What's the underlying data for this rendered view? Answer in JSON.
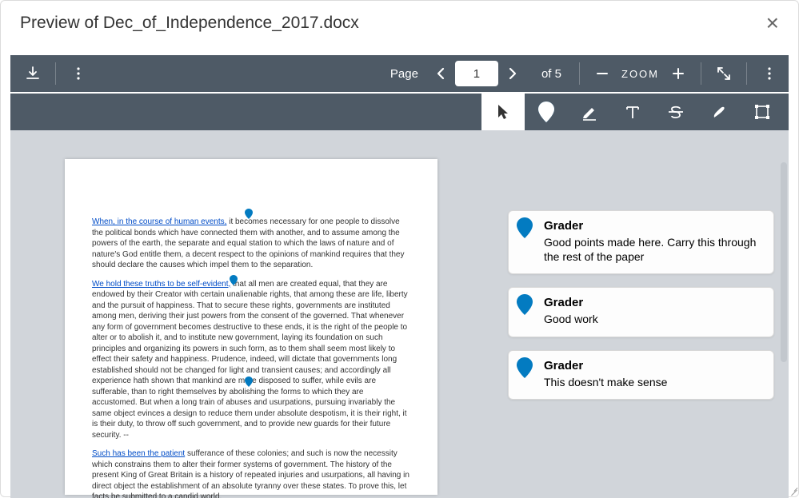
{
  "header": {
    "title": "Preview of Dec_of_Independence_2017.docx"
  },
  "toolbar": {
    "page_label": "Page",
    "page_current": "1",
    "page_of": "of 5",
    "zoom_label": "ZOOM"
  },
  "document": {
    "para1_link": "When, in the course of human events,",
    "para1_rest": " it becomes necessary for one people to dissolve the political bonds which have connected them with another, and to assume among the powers of the earth, the separate and equal station to which the laws of nature and of nature's God entitle them, a decent respect to the opinions of mankind requires that they should declare the causes which impel them to the separation.",
    "para2_link": "We hold these truths to be self-evident,",
    "para2_rest": " that all men are created equal, that they are endowed by their Creator with certain unalienable rights, that among these are life, liberty and the pursuit of happiness. That to secure these rights, governments are instituted among men, deriving their just powers from the consent of the governed. That whenever any form of government becomes destructive to these ends, it is the right of the people to alter or to abolish it, and to institute new government, laying its foundation on such principles and organizing its powers in such form, as to them shall seem most likely to effect their safety and happiness. Prudence, indeed, will dictate that governments long established should not be changed for light and transient causes; and accordingly all experience hath shown that mankind are more disposed to suffer, while evils are sufferable, than to right themselves by abolishing the forms to which they are accustomed. But when a long train of abuses and usurpations, pursuing invariably the same object evinces a design to reduce them under absolute despotism, it is their right, it is their duty, to throw off such government, and to provide new guards for their future security. --",
    "para3_link": "Such has been the patient",
    "para3_rest": " sufferance of these colonies; and such is now the necessity which constrains them to alter their former systems of government. The history of the present King of Great Britain is a history of repeated injuries and usurpations, all having in direct object the establishment of an absolute tyranny over these states. To prove this, let facts be submitted to a candid world."
  },
  "comments": [
    {
      "author": "Grader",
      "body": "Good points made here. Carry this through the rest of the paper"
    },
    {
      "author": "Grader",
      "body": "Good work"
    },
    {
      "author": "Grader",
      "body": "This doesn't make sense"
    }
  ],
  "colors": {
    "pin": "#037bc1"
  }
}
